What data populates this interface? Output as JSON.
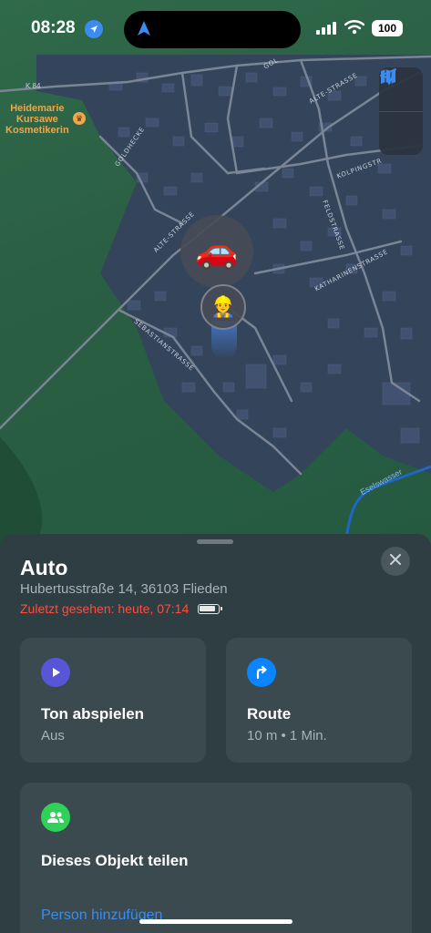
{
  "status_bar": {
    "time": "08:28",
    "battery": "100",
    "icons": [
      "location-arrow-icon",
      "navigation-icon",
      "cellular-signal-icon",
      "wifi-icon",
      "battery-icon"
    ]
  },
  "map": {
    "poi": {
      "name_line1": "Heidemarie",
      "name_line2": "Kursawe",
      "name_line3": "Kosmetikerin",
      "icon": "crown-icon"
    },
    "road_label": "K 84",
    "street_labels": {
      "alte_strasse_1": "ALTE-STRASSE",
      "alte_strasse_2": "ALTE-STRASSE",
      "goldhecke": "GOLDHECKE",
      "kolpingstr": "KOLPINGSTR",
      "feldstrasse": "FELDSTRASSE",
      "katharinenstrasse": "KATHARINENSTRASSE",
      "sebastianstrasse": "SEBASTIANSTRASSE",
      "gol": "GOL"
    },
    "water_label": "Eselswasser",
    "markers": {
      "car": "🚗",
      "person": "👷"
    },
    "controls": [
      "map-icon",
      "location-arrow-icon"
    ]
  },
  "sheet": {
    "title": "Auto",
    "address": "Hubertusstraße 14, 36103 Flieden",
    "last_seen": "Zuletzt gesehen: heute, 07:14",
    "cards": {
      "sound": {
        "title": "Ton abspielen",
        "subtitle": "Aus",
        "icon": "play-icon",
        "color": "#5856d6"
      },
      "route": {
        "title": "Route",
        "subtitle": "10 m • 1 Min.",
        "icon": "turn-right-arrow-icon",
        "color": "#0a84ff"
      },
      "share": {
        "title": "Dieses Objekt teilen",
        "link": "Person hinzufügen",
        "icon": "people-icon",
        "color": "#30d158"
      }
    }
  },
  "colors": {
    "accent": "#3a8cf0",
    "alert": "#ff4d3f",
    "sheet_bg": "#2f3e42",
    "card_bg": "#3a4a4e"
  }
}
